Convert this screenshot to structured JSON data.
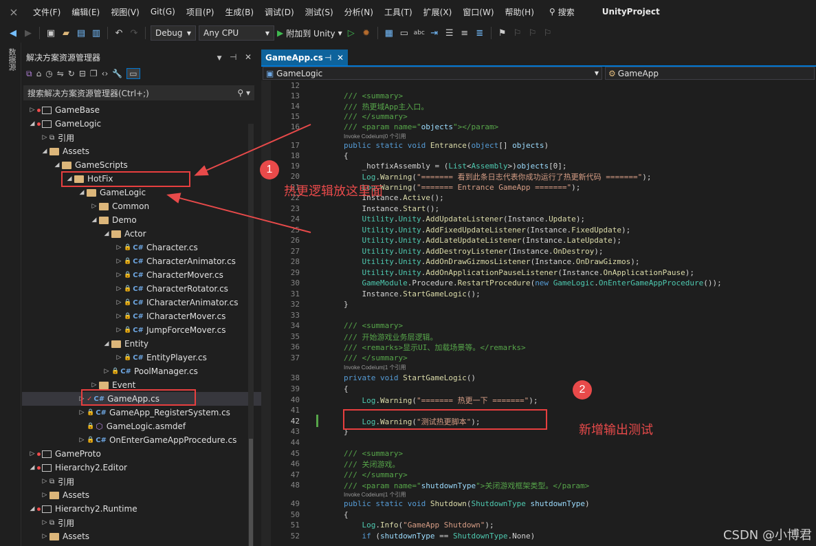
{
  "menubar": {
    "items": [
      "文件(F)",
      "编辑(E)",
      "视图(V)",
      "Git(G)",
      "项目(P)",
      "生成(B)",
      "调试(D)",
      "测试(S)",
      "分析(N)",
      "工具(T)",
      "扩展(X)",
      "窗口(W)",
      "帮助(H)"
    ],
    "search_label": "搜索",
    "project": "UnityProject"
  },
  "toolbar": {
    "config": "Debug",
    "platform": "Any CPU",
    "attach_label": "附加到 Unity"
  },
  "side_strip": {
    "label": "数据源"
  },
  "solution_explorer": {
    "title": "解决方案资源管理器",
    "search_placeholder": "搜索解决方案资源管理器(Ctrl+;)",
    "items": [
      {
        "label": "GameBase"
      },
      {
        "label": "GameLogic"
      },
      {
        "label": "引用"
      },
      {
        "label": "Assets"
      },
      {
        "label": "GameScripts"
      },
      {
        "label": "HotFix"
      },
      {
        "label": "GameLogic"
      },
      {
        "label": "Common"
      },
      {
        "label": "Demo"
      },
      {
        "label": "Actor"
      },
      {
        "label": "Character.cs"
      },
      {
        "label": "CharacterAnimator.cs"
      },
      {
        "label": "CharacterMover.cs"
      },
      {
        "label": "CharacterRotator.cs"
      },
      {
        "label": "ICharacterAnimator.cs"
      },
      {
        "label": "ICharacterMover.cs"
      },
      {
        "label": "JumpForceMover.cs"
      },
      {
        "label": "Entity"
      },
      {
        "label": "EntityPlayer.cs"
      },
      {
        "label": "PoolManager.cs"
      },
      {
        "label": "Event"
      },
      {
        "label": "GameApp.cs"
      },
      {
        "label": "GameApp_RegisterSystem.cs"
      },
      {
        "label": "GameLogic.asmdef"
      },
      {
        "label": "OnEnterGameAppProcedure.cs"
      },
      {
        "label": "GameProto"
      },
      {
        "label": "Hierarchy2.Editor"
      },
      {
        "label": "引用"
      },
      {
        "label": "Assets"
      },
      {
        "label": "Hierarchy2.Runtime"
      },
      {
        "label": "引用"
      },
      {
        "label": "Assets"
      }
    ]
  },
  "editor": {
    "tab_label": "GameApp.cs",
    "nav_left": "GameLogic",
    "nav_right": "GameApp",
    "codelens_1": "Invoke Codeium|0 个引用",
    "codelens_2": "Invoke Codeium|1 个引用",
    "codelens_3": "Invoke Codeium|1 个引用"
  },
  "annotations": {
    "badge1": "1",
    "badge2": "2",
    "text1": "热更逻辑放这里面",
    "text2": "新增输出测试"
  },
  "watermark": "CSDN @小博君",
  "colors": {
    "accent": "#0e639c",
    "annotation_red": "#e84a4a",
    "folder": "#dcb67a",
    "comment": "#57a64a",
    "keyword": "#569cd6",
    "type": "#4ec9b0",
    "string": "#d69d85"
  }
}
